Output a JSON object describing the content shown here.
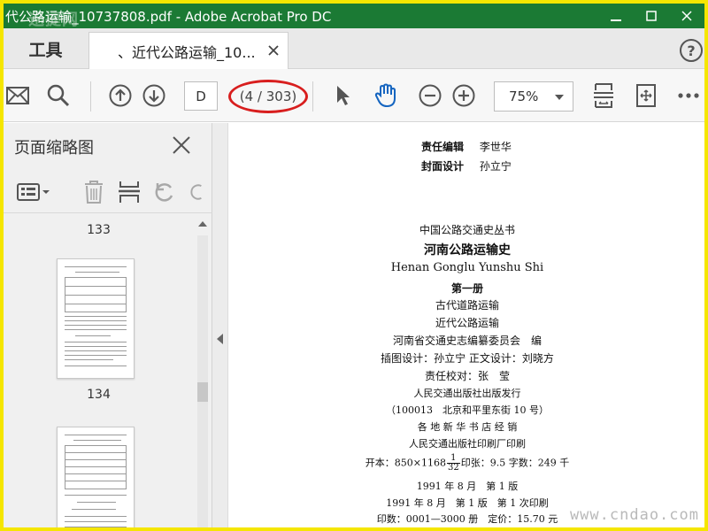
{
  "titlebar": {
    "title": "代公路运输_10737808.pdf - Adobe Acrobat Pro DC",
    "watermark": "迅捷网"
  },
  "tabs": {
    "tools_label": "工具",
    "document_label": "、近代公路运输_10...",
    "help_label": "?"
  },
  "toolbar": {
    "page_input": "D",
    "page_count": "(4 / 303)",
    "zoom": "75%",
    "icons": [
      "mail-icon",
      "search-icon",
      "arrow-up-icon",
      "arrow-down-icon",
      "pointer-icon",
      "hand-icon",
      "zoom-out-icon",
      "zoom-in-icon",
      "fit-page-icon",
      "rotate-icon",
      "more-icon"
    ]
  },
  "panel": {
    "title": "页面缩略图",
    "thumbnails": [
      {
        "label": "133"
      },
      {
        "label": "134"
      }
    ]
  },
  "doc": {
    "editor_label": "责任编辑",
    "editor_name": "李世华",
    "cover_label": "封面设计",
    "cover_name": "孙立宁",
    "series": "中国公路交通史丛书",
    "book_title": "河南公路运输史",
    "pinyin": "Henan Gonglu Yunshu Shi",
    "volume": "第一册",
    "part1": "古代道路运输",
    "part2": "近代公路运输",
    "compiler": "河南省交通史志编纂委员会　编",
    "illustrators": "插图设计：孙立宁  正文设计：刘晓方",
    "proofreader": "责任校对：张　莹",
    "publisher": "人民交通出版社出版发行",
    "address": "（100013　北京和平里东街 10 号）",
    "distributor": "各 地 新 华 书 店 经 销",
    "printer": "人民交通出版社印刷厂印刷",
    "format_prefix": "开本：850×1168",
    "format_num": "1",
    "format_den": "32",
    "format_suffix": "印张：9.5 字数：249 千",
    "edition": "1991 年 8 月　第 1 版",
    "printing": "1991 年 8 月　第 1 版　第 1 次印刷",
    "copies": "印数：0001—3000 册　定价：15.70 元"
  },
  "site_mark": "www.cndao.com"
}
